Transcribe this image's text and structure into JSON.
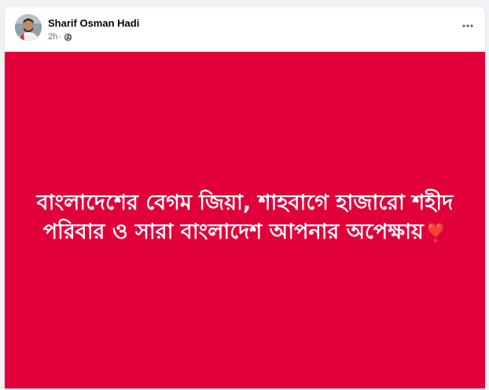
{
  "post": {
    "author_name": "Sharif Osman Hadi",
    "time_ago": "2h",
    "separator": "·",
    "audience_icon": "globe-icon",
    "more_icon": "more-options-icon",
    "background_color": "#e2003a",
    "text": "বাংলাদেশের বেগম জিয়া, শাহবাগে হাজারো শহীদ পরিবার ও সারা বাংলাদেশ আপনার অপেক্ষায়",
    "emoji": "❣️"
  }
}
